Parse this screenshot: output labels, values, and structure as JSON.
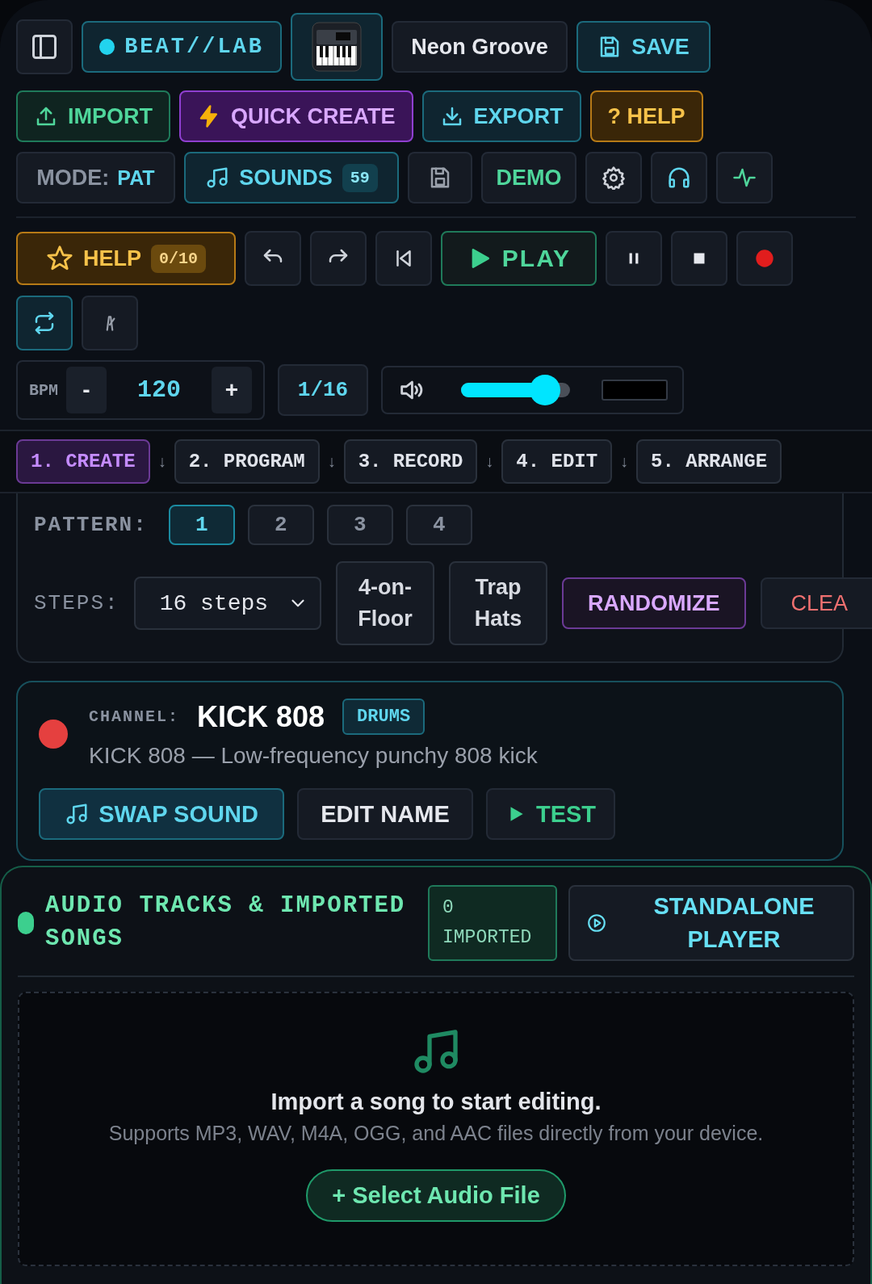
{
  "header": {
    "logo": "BEAT//LAB",
    "project_name": "Neon Groove",
    "save": "SAVE"
  },
  "actions": [
    {
      "kind": "import",
      "label": "IMPORT"
    },
    {
      "kind": "quick",
      "label": "QUICK CREATE"
    },
    {
      "kind": "export",
      "label": "EXPORT"
    },
    {
      "kind": "help",
      "label": "? HELP"
    }
  ],
  "tools": {
    "mode_label": "MODE:",
    "mode_value": "PAT",
    "sounds_label": "SOUNDS",
    "sounds_count": "59",
    "demo": "DEMO"
  },
  "transport": {
    "help_label": "HELP",
    "help_progress": "0/10",
    "play": "PLAY",
    "loop_on": true,
    "metronome_on": false
  },
  "tempo": {
    "bpm_label": "BPM",
    "minus": "-",
    "bpm": "120",
    "plus": "+",
    "quantize": "1/16",
    "volume": {
      "level": 0.77
    }
  },
  "workflow": [
    {
      "label": "1. CREATE",
      "selected": true,
      "arrow": "↓"
    },
    {
      "label": "2. PROGRAM",
      "selected": false,
      "arrow": "↓"
    },
    {
      "label": "3. RECORD",
      "selected": false,
      "arrow": "↓"
    },
    {
      "label": "4. EDIT",
      "selected": false,
      "arrow": "↓"
    },
    {
      "label": "5. ARRANGE",
      "selected": false
    }
  ],
  "pattern": {
    "label": "PATTERN:",
    "patterns": [
      {
        "label": "1",
        "selected": true
      },
      {
        "label": "2",
        "selected": false
      },
      {
        "label": "3",
        "selected": false
      },
      {
        "label": "4",
        "selected": false
      }
    ]
  },
  "steps": {
    "label": "STEPS:",
    "value": "16 steps",
    "presets": [
      "4-on-Floor",
      "Trap Hats"
    ],
    "randomize": "RANDOMIZE",
    "clear": "CLEA"
  },
  "channel": {
    "label": "CHANNEL:",
    "name": "KICK 808",
    "tag": "DRUMS",
    "color": "#e5403f",
    "description": "KICK 808 — Low-frequency punchy 808 kick",
    "swap": "SWAP SOUND",
    "edit": "EDIT NAME",
    "test": "TEST"
  },
  "audio": {
    "title": "AUDIO TRACKS & IMPORTED SONGS",
    "imported": "0 IMPORTED",
    "player": "STANDALONE PLAYER",
    "empty_title": "Import a song to start editing.",
    "empty_text": "Supports MP3, WAV, M4A, OGG, and AAC files directly from your device.",
    "select": "+ Select Audio File"
  }
}
